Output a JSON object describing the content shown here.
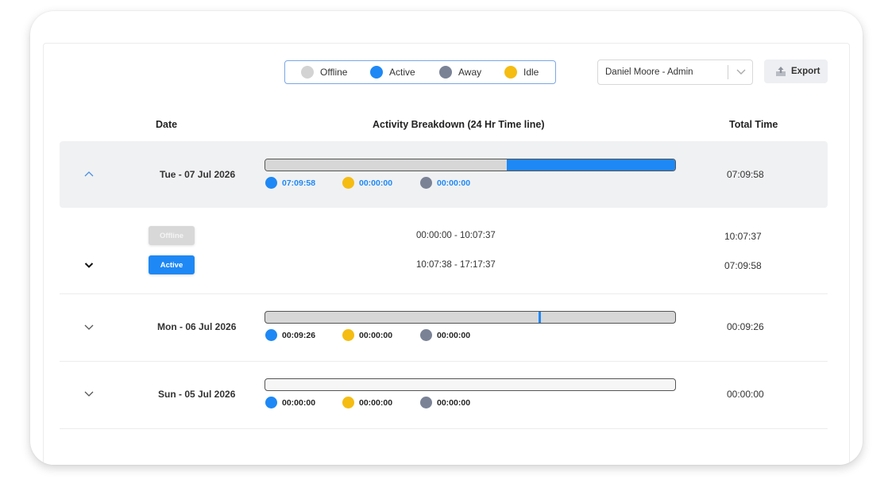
{
  "legend": [
    {
      "label": "Offline",
      "color": "#d3d3d3"
    },
    {
      "label": "Active",
      "color": "#1e88f5"
    },
    {
      "label": "Away",
      "color": "#7a8296"
    },
    {
      "label": "Idle",
      "color": "#f5bc12"
    }
  ],
  "user_select": {
    "value": "Daniel Moore - Admin"
  },
  "export": {
    "label": "Export"
  },
  "table": {
    "headers": {
      "date": "Date",
      "breakdown": "Activity Breakdown (24 Hr Time line)",
      "total": "Total Time"
    }
  },
  "days": [
    {
      "date": "Tue - 07 Jul 2026",
      "expanded": true,
      "active": "07:09:58",
      "idle": "00:00:00",
      "away": "00:00:00",
      "total": "07:09:58",
      "timeline": [
        {
          "status": "offline",
          "start_pct": 0,
          "end_pct": 58.9
        },
        {
          "status": "active",
          "start_pct": 58.9,
          "end_pct": 100
        }
      ],
      "details": [
        {
          "status": "Offline",
          "range": "00:00:00 - 10:07:37",
          "duration": "10:07:37"
        },
        {
          "status": "Active",
          "range": "10:07:38 - 17:17:37",
          "duration": "07:09:58"
        }
      ]
    },
    {
      "date": "Mon - 06 Jul 2026",
      "expanded": false,
      "active": "00:09:26",
      "idle": "00:00:00",
      "away": "00:00:00",
      "total": "00:09:26",
      "timeline": [
        {
          "status": "active",
          "start_pct": 66.6,
          "end_pct": 67.3
        }
      ]
    },
    {
      "date": "Sun - 05 Jul 2026",
      "expanded": false,
      "active": "00:00:00",
      "idle": "00:00:00",
      "away": "00:00:00",
      "total": "00:00:00",
      "timeline": []
    }
  ]
}
